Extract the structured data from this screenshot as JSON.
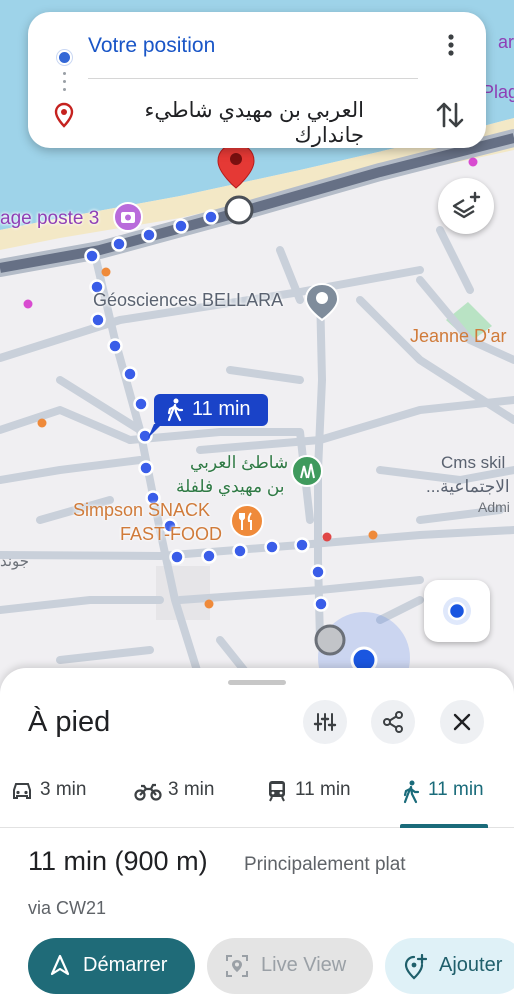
{
  "search": {
    "origin": "Votre position",
    "destination": "العربي بن مهيدي شاطيء جاندارك"
  },
  "map_labels": {
    "plage_poste": "age poste 3",
    "geosciences": "Géosciences BELLARA",
    "jeanne": "Jeanne D'ar",
    "cms_line1": "Cms skil",
    "cms_line2": "...الاجتماعية",
    "cms_line3": "Admi",
    "park_line1": "شاطئ العربي",
    "park_line2": "بن مهيدي فلفلة",
    "snack_line1": "Simpson SNACK",
    "snack_line2": "FAST-FOOD",
    "left_edge": "جوند",
    "top_right": "Plag",
    "top_right2": "ar"
  },
  "route_bubble": {
    "label": "11 min"
  },
  "sheet": {
    "title": "À pied",
    "tabs": [
      {
        "mode": "car",
        "label": "3 min",
        "icon": "car-icon"
      },
      {
        "mode": "motorbike",
        "label": "3 min",
        "icon": "motorbike-icon"
      },
      {
        "mode": "transit",
        "label": "11 min",
        "icon": "train-icon"
      },
      {
        "mode": "walk",
        "label": "11 min",
        "icon": "walk-icon",
        "selected": true
      }
    ],
    "summary": "11 min (900 m)",
    "summary_note": "Principalement plat",
    "via": "via CW21",
    "buttons": {
      "start": "Démarrer",
      "live_view": "Live View",
      "add": "Ajouter"
    }
  },
  "colors": {
    "route": "#3a5de8",
    "accent_teal": "#1f6b78",
    "origin_blue": "#3367d6",
    "pin_red": "#d93025",
    "sea": "#9ed3e9"
  }
}
